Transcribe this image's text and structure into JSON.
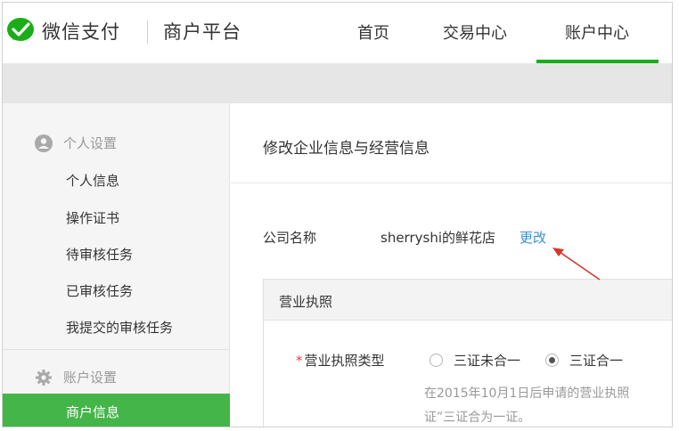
{
  "header": {
    "brand": "微信支付",
    "platform": "商户平台",
    "tabs": [
      {
        "label": "首页"
      },
      {
        "label": "交易中心"
      },
      {
        "label": "账户中心",
        "active": true
      }
    ]
  },
  "sidebar": {
    "sections": [
      {
        "title": "个人设置",
        "icon": "user-icon",
        "items": [
          "个人信息",
          "操作证书",
          "待审核任务",
          "已审核任务",
          "我提交的审核任务"
        ]
      },
      {
        "title": "账户设置",
        "icon": "gear-icon",
        "items": [
          "商户信息"
        ],
        "active_item": "商户信息"
      }
    ]
  },
  "main": {
    "title": "修改企业信息与经营信息",
    "company": {
      "label": "公司名称",
      "value": "sherryshi的鲜花店",
      "action": "更改"
    },
    "license": {
      "header": "营业执照",
      "required_mark": "*",
      "type_label": "营业执照类型",
      "options": [
        {
          "label": "三证未合一",
          "checked": false
        },
        {
          "label": "三证合一",
          "checked": true
        }
      ],
      "hint_line1": "在2015年10月1日后申请的营业执照",
      "hint_line2": "证”三证合为一证。"
    }
  },
  "colors": {
    "brand_green": "#1aad19",
    "active_bg": "#44b549",
    "link_blue": "#3a8dd6",
    "annotation_red": "#d9362f"
  }
}
